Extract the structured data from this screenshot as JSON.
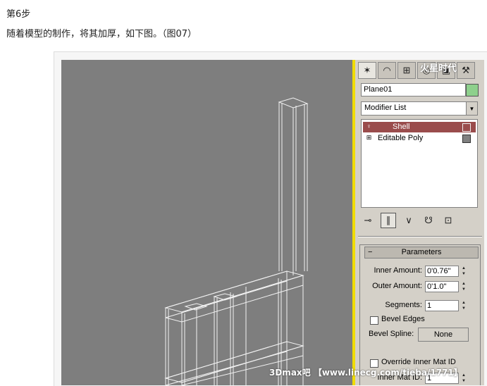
{
  "article": {
    "step": "第6步",
    "description": "随着模型的制作，将其加厚，如下图。（图07）"
  },
  "command_panel": {
    "tabs": [
      {
        "icon": "create-icon",
        "glyph": "✶"
      },
      {
        "icon": "modify-icon",
        "glyph": "◠"
      },
      {
        "icon": "hierarchy-icon",
        "glyph": "⊞"
      },
      {
        "icon": "motion-icon",
        "glyph": "◎"
      },
      {
        "icon": "display-icon",
        "glyph": "▣"
      },
      {
        "icon": "utilities-icon",
        "glyph": "⚒"
      }
    ],
    "object_name": "Plane01",
    "object_color": "#8ed08c",
    "modifier_list_label": "Modifier List",
    "stack": [
      {
        "label": "Shell",
        "selected": true,
        "icon": "lightbulb-icon"
      },
      {
        "label": "Editable Poly",
        "selected": false,
        "icon": "expand-plus-icon"
      }
    ],
    "parameters": {
      "header": "Parameters",
      "inner_amount_label": "Inner Amount:",
      "inner_amount_value": "0'0.76\"",
      "outer_amount_label": "Outer Amount:",
      "outer_amount_value": "0'1.0\"",
      "segments_label": "Segments:",
      "segments_value": "1",
      "bevel_edges_label": "Bevel Edges",
      "bevel_spline_label": "Bevel Spline:",
      "bevel_spline_button": "None",
      "override_inner_label": "Override Inner Mat ID",
      "inner_mat_id_label": "Inner Mat ID:",
      "inner_mat_id_value": "1"
    }
  },
  "watermark": "3Dmax吧 【www.linecg.com/tieba/1771】",
  "logo_text": "火星时代",
  "colors": {
    "viewport_bg": "#7e7e7e",
    "viewport_border": "#f0dc00",
    "selected_modifier": "#9a4c4c",
    "panel_bg": "#d4d0c8"
  }
}
